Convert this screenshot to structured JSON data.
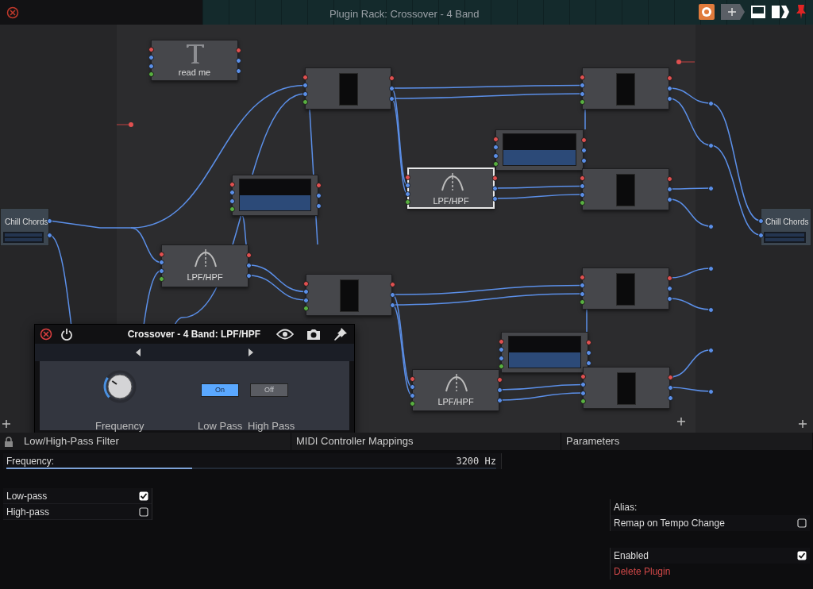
{
  "window": {
    "title": "Plugin Rack: Crossover - 4 Band"
  },
  "nodes": [
    {
      "kind": "text",
      "label": "read me"
    },
    {
      "kind": "plugin"
    },
    {
      "kind": "meter"
    },
    {
      "kind": "filter",
      "label": "LPF/HPF",
      "selected": false
    },
    {
      "kind": "plugin"
    },
    {
      "kind": "plugin"
    },
    {
      "kind": "meter"
    },
    {
      "kind": "filter",
      "label": "LPF/HPF",
      "selected": true
    },
    {
      "kind": "plugin"
    },
    {
      "kind": "plugin"
    },
    {
      "kind": "meter"
    },
    {
      "kind": "filter",
      "label": "LPF/HPF",
      "selected": false
    },
    {
      "kind": "plugin"
    },
    {
      "kind": "io",
      "label": "Chill Chords"
    },
    {
      "kind": "io",
      "label": "Chill Chords"
    }
  ],
  "plugin_window": {
    "title": "Crossover - 4 Band: LPF/HPF",
    "knob": {
      "label": "Frequency",
      "level": 0.3
    },
    "toggles": [
      {
        "label": "Low Pass",
        "value": "On",
        "on": true
      },
      {
        "label": "High Pass",
        "value": "Off",
        "on": false
      }
    ]
  },
  "tabs": [
    {
      "label": "Low/High-Pass Filter",
      "locked": true
    },
    {
      "label": "MIDI Controller Mappings",
      "locked": false
    },
    {
      "label": "Parameters",
      "locked": false
    }
  ],
  "parameters": {
    "slider": {
      "label": "Frequency:",
      "reading": "3200 Hz",
      "level": 0.38
    },
    "checkboxes": [
      {
        "label": "Low-pass",
        "checked": true
      },
      {
        "label": "High-pass",
        "checked": false
      }
    ]
  },
  "settings": {
    "alias": "Alias:",
    "options": [
      {
        "label": "Remap on Tempo Change",
        "checked": false
      },
      {
        "label": "Enabled",
        "checked": true
      }
    ],
    "delete": "Delete Plugin"
  }
}
